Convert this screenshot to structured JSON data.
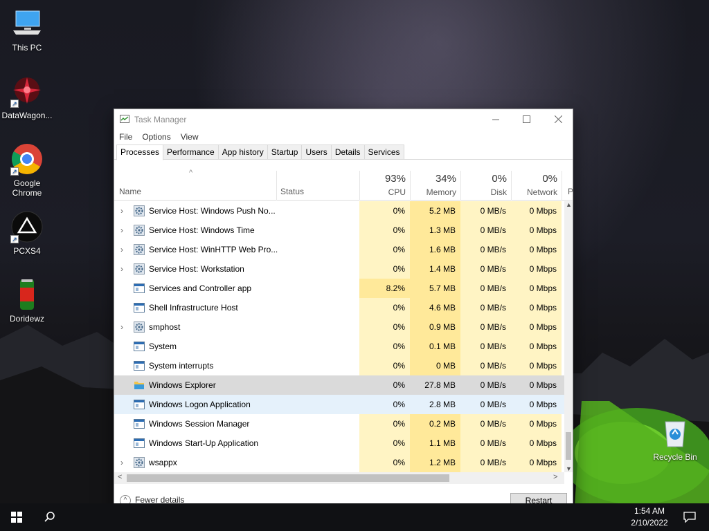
{
  "desktop": {
    "icons": [
      {
        "label": "This PC",
        "icon": "computer-icon"
      },
      {
        "label": "DataWagon...",
        "icon": "datawagon-icon"
      },
      {
        "label": "Google Chrome",
        "icon": "chrome-icon"
      },
      {
        "label": "PCXS4",
        "icon": "pcxs4-icon"
      },
      {
        "label": "Doridewz",
        "icon": "mountain-dew-icon"
      },
      {
        "label": "Recycle Bin",
        "icon": "recycle-bin-icon"
      }
    ]
  },
  "window": {
    "title": "Task Manager",
    "menu": [
      "File",
      "Options",
      "View"
    ],
    "tabs": [
      "Processes",
      "Performance",
      "App history",
      "Startup",
      "Users",
      "Details",
      "Services"
    ],
    "active_tab": "Processes",
    "columns": {
      "name": "Name",
      "status": "Status",
      "cpu": {
        "pct": "93%",
        "label": "CPU"
      },
      "memory": {
        "pct": "34%",
        "label": "Memory"
      },
      "disk": {
        "pct": "0%",
        "label": "Disk"
      },
      "network": {
        "pct": "0%",
        "label": "Network"
      },
      "next": "P"
    },
    "rows": [
      {
        "name": "Service Host: Windows Push No...",
        "cpu": "0%",
        "mem": "5.2 MB",
        "disk": "0 MB/s",
        "net": "0 Mbps",
        "expand": true,
        "icon": "gear-icon"
      },
      {
        "name": "Service Host: Windows Time",
        "cpu": "0%",
        "mem": "1.3 MB",
        "disk": "0 MB/s",
        "net": "0 Mbps",
        "expand": true,
        "icon": "gear-icon"
      },
      {
        "name": "Service Host: WinHTTP Web Pro...",
        "cpu": "0%",
        "mem": "1.6 MB",
        "disk": "0 MB/s",
        "net": "0 Mbps",
        "expand": true,
        "icon": "gear-icon"
      },
      {
        "name": "Service Host: Workstation",
        "cpu": "0%",
        "mem": "1.4 MB",
        "disk": "0 MB/s",
        "net": "0 Mbps",
        "expand": true,
        "icon": "gear-icon"
      },
      {
        "name": "Services and Controller app",
        "cpu": "8.2%",
        "mem": "5.7 MB",
        "disk": "0 MB/s",
        "net": "0 Mbps",
        "expand": false,
        "icon": "window-app-icon"
      },
      {
        "name": "Shell Infrastructure Host",
        "cpu": "0%",
        "mem": "4.6 MB",
        "disk": "0 MB/s",
        "net": "0 Mbps",
        "expand": false,
        "icon": "window-app-icon"
      },
      {
        "name": "smphost",
        "cpu": "0%",
        "mem": "0.9 MB",
        "disk": "0 MB/s",
        "net": "0 Mbps",
        "expand": true,
        "icon": "gear-icon"
      },
      {
        "name": "System",
        "cpu": "0%",
        "mem": "0.1 MB",
        "disk": "0 MB/s",
        "net": "0 Mbps",
        "expand": false,
        "icon": "window-app-icon"
      },
      {
        "name": "System interrupts",
        "cpu": "0%",
        "mem": "0 MB",
        "disk": "0 MB/s",
        "net": "0 Mbps",
        "expand": false,
        "icon": "window-app-icon"
      },
      {
        "name": "Windows Explorer",
        "cpu": "0%",
        "mem": "27.8 MB",
        "disk": "0 MB/s",
        "net": "0 Mbps",
        "expand": false,
        "icon": "folder-icon"
      },
      {
        "name": "Windows Logon Application",
        "cpu": "0%",
        "mem": "2.8 MB",
        "disk": "0 MB/s",
        "net": "0 Mbps",
        "expand": false,
        "icon": "window-app-icon"
      },
      {
        "name": "Windows Session Manager",
        "cpu": "0%",
        "mem": "0.2 MB",
        "disk": "0 MB/s",
        "net": "0 Mbps",
        "expand": false,
        "icon": "window-app-icon"
      },
      {
        "name": "Windows Start-Up Application",
        "cpu": "0%",
        "mem": "1.1 MB",
        "disk": "0 MB/s",
        "net": "0 Mbps",
        "expand": false,
        "icon": "window-app-icon"
      },
      {
        "name": "wsappx",
        "cpu": "0%",
        "mem": "1.2 MB",
        "disk": "0 MB/s",
        "net": "0 Mbps",
        "expand": true,
        "icon": "gear-icon"
      }
    ],
    "selected_row": "Windows Explorer",
    "hover_row": "Windows Logon Application",
    "footer": {
      "fewer_details": "Fewer details",
      "restart": "Restart"
    }
  },
  "taskbar": {
    "time": "1:54 AM",
    "date": "2/10/2022"
  },
  "colors": {
    "heat_light": "#fff4c4",
    "heat_medium": "#ffe99a",
    "selected": "#dadada",
    "hover": "#e5f1fb"
  }
}
